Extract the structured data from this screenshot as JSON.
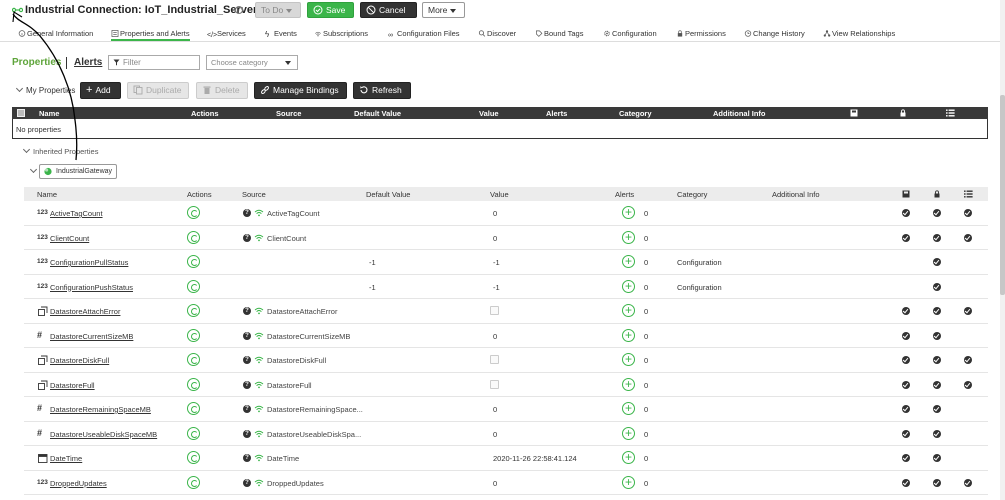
{
  "header": {
    "title": "Industrial Connection: IoT_Industrial_Server",
    "help_icon": "?",
    "state_label": "To Do",
    "save_label": "Save",
    "cancel_label": "Cancel",
    "more_label": "More"
  },
  "tabs": [
    {
      "label": "General Information",
      "icon": "info-icon"
    },
    {
      "label": "Properties and Alerts",
      "icon": "list-icon",
      "active": true
    },
    {
      "label": "Services",
      "icon": "code-icon"
    },
    {
      "label": "Events",
      "icon": "bolt-icon"
    },
    {
      "label": "Subscriptions",
      "icon": "wifi-icon"
    },
    {
      "label": "Configuration Files",
      "icon": "link-icon"
    },
    {
      "label": "Discover",
      "icon": "search-icon"
    },
    {
      "label": "Bound Tags",
      "icon": "tag-icon"
    },
    {
      "label": "Configuration",
      "icon": "gear-icon"
    },
    {
      "label": "Permissions",
      "icon": "lock-icon"
    },
    {
      "label": "Change History",
      "icon": "clock-icon"
    },
    {
      "label": "View Relationships",
      "icon": "network-icon"
    }
  ],
  "subtabs": {
    "properties": "Properties",
    "alerts": "Alerts"
  },
  "filter": {
    "placeholder": "Filter"
  },
  "category": {
    "placeholder": "Choose category"
  },
  "my_properties": {
    "label": "My Properties",
    "add": "Add",
    "duplicate": "Duplicate",
    "delete": "Delete",
    "manage_bindings": "Manage Bindings",
    "refresh": "Refresh",
    "columns": [
      "Name",
      "Actions",
      "Source",
      "Default Value",
      "Value",
      "Alerts",
      "Category",
      "Additional Info"
    ],
    "empty_text": "No properties"
  },
  "inherited": {
    "label": "Inherited Properties",
    "gateway": "IndustrialGateway",
    "columns": [
      "Name",
      "Actions",
      "Source",
      "Default Value",
      "Value",
      "Alerts",
      "Category",
      "Additional Info"
    ],
    "rows": [
      {
        "type": "123",
        "name": "ActiveTagCount",
        "source": "ActiveTagCount",
        "default": "",
        "value": "0",
        "checkbox": false,
        "alerts": "0",
        "category": "",
        "c1": true,
        "c2": true,
        "c3": true
      },
      {
        "type": "123",
        "name": "ClientCount",
        "source": "ClientCount",
        "default": "",
        "value": "0",
        "checkbox": false,
        "alerts": "0",
        "category": "",
        "c1": true,
        "c2": true,
        "c3": true
      },
      {
        "type": "123",
        "name": "ConfigurationPullStatus",
        "source": "",
        "default": "-1",
        "value": "-1",
        "checkbox": false,
        "alerts": "0",
        "category": "Configuration",
        "c1": false,
        "c2": true,
        "c3": false
      },
      {
        "type": "123",
        "name": "ConfigurationPushStatus",
        "source": "",
        "default": "-1",
        "value": "-1",
        "checkbox": false,
        "alerts": "0",
        "category": "Configuration",
        "c1": false,
        "c2": true,
        "c3": false
      },
      {
        "type": "bool",
        "name": "DatastoreAttachError",
        "source": "DatastoreAttachError",
        "default": "",
        "value": "",
        "checkbox": true,
        "alerts": "0",
        "category": "",
        "c1": true,
        "c2": true,
        "c3": true
      },
      {
        "type": "#",
        "name": "DatastoreCurrentSizeMB",
        "source": "DatastoreCurrentSizeMB",
        "default": "",
        "value": "0",
        "checkbox": false,
        "alerts": "0",
        "category": "",
        "c1": true,
        "c2": true,
        "c3": false
      },
      {
        "type": "bool",
        "name": "DatastoreDiskFull",
        "source": "DatastoreDiskFull",
        "default": "",
        "value": "",
        "checkbox": true,
        "alerts": "0",
        "category": "",
        "c1": true,
        "c2": true,
        "c3": true
      },
      {
        "type": "bool",
        "name": "DatastoreFull",
        "source": "DatastoreFull",
        "default": "",
        "value": "",
        "checkbox": true,
        "alerts": "0",
        "category": "",
        "c1": true,
        "c2": true,
        "c3": true
      },
      {
        "type": "#",
        "name": "DatastoreRemainingSpaceMB",
        "source": "DatastoreRemainingSpace...",
        "default": "",
        "value": "0",
        "checkbox": false,
        "alerts": "0",
        "category": "",
        "c1": true,
        "c2": true,
        "c3": false
      },
      {
        "type": "#",
        "name": "DatastoreUseableDiskSpaceMB",
        "source": "DatastoreUseableDiskSpa...",
        "default": "",
        "value": "0",
        "checkbox": false,
        "alerts": "0",
        "category": "",
        "c1": true,
        "c2": true,
        "c3": false
      },
      {
        "type": "date",
        "name": "DateTime",
        "source": "DateTime",
        "default": "",
        "value": "2020-11-26 22:58:41.124",
        "checkbox": false,
        "alerts": "0",
        "category": "",
        "c1": true,
        "c2": true,
        "c3": false
      },
      {
        "type": "123",
        "name": "DroppedUpdates",
        "source": "DroppedUpdates",
        "default": "",
        "value": "0",
        "checkbox": false,
        "alerts": "0",
        "category": "",
        "c1": true,
        "c2": true,
        "c3": true
      }
    ]
  },
  "colors": {
    "accent": "#3bb54a",
    "dark": "#333333",
    "header_bg": "#3a3a3a"
  }
}
